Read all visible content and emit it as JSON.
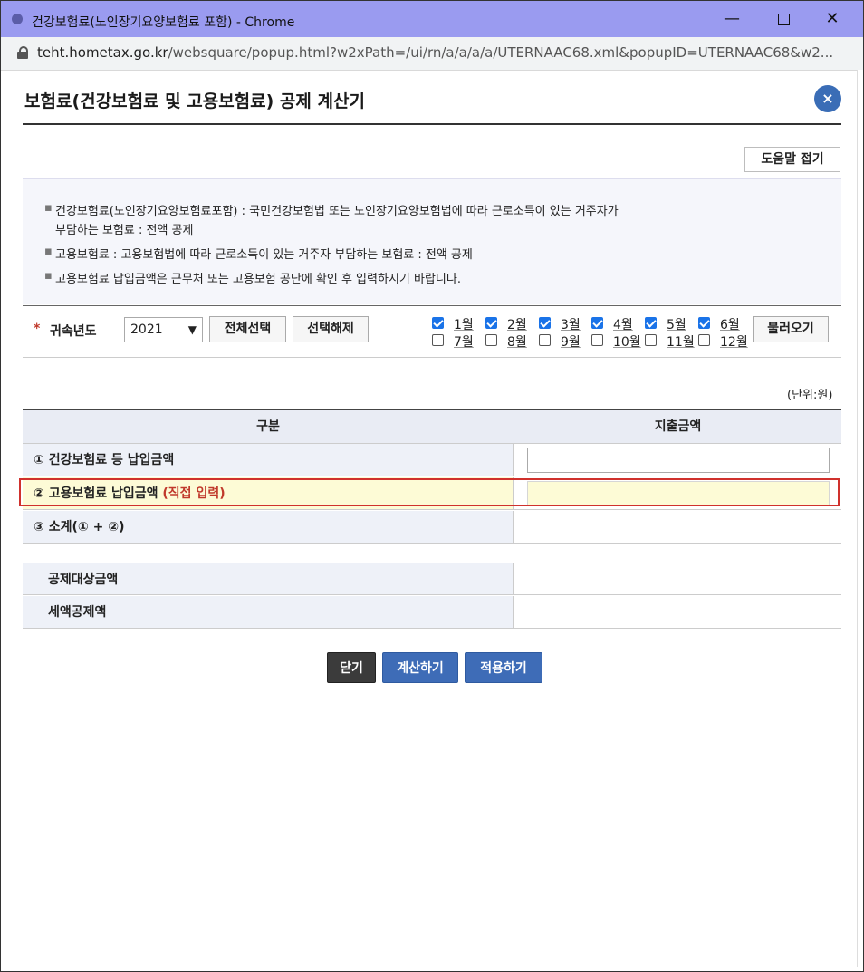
{
  "window": {
    "title": "건강보험료(노인장기요양보험료 포함) - Chrome",
    "url_domain": "teht.hometax.go.kr",
    "url_path": "/websquare/popup.html?w2xPath=/ui/rn/a/a/a/a/UTERNAAC68.xml&popupID=UTERNAAC68&w2..."
  },
  "dialog": {
    "title": "보험료(건강보험료 및 고용보험료) 공제 계산기",
    "close_glyph": "×"
  },
  "help": {
    "toggle_label": "도움말 접기",
    "lines": [
      "건강보험료(노인장기요양보험료포함) : 국민건강보험법 또는 노인장기요양보험법에 따라 근로소득이 있는 거주자가",
      "부담하는 보험료 : 전액 공제",
      "고용보험료 : 고용보험법에 따라 근로소득이 있는 거주자 부담하는 보험료 : 전액 공제",
      "고용보험료 납입금액은 근무처 또는 고용보험 공단에 확인 후 입력하시기 바랍니다."
    ]
  },
  "controls": {
    "required_mark": "*",
    "year_label": "귀속년도",
    "year_value": "2021",
    "select_all_label": "전체선택",
    "clear_selection_label": "선택해제",
    "load_label": "불러오기",
    "months": [
      {
        "label": "1월",
        "checked": true
      },
      {
        "label": "2월",
        "checked": true
      },
      {
        "label": "3월",
        "checked": true
      },
      {
        "label": "4월",
        "checked": true
      },
      {
        "label": "5월",
        "checked": true
      },
      {
        "label": "6월",
        "checked": true
      },
      {
        "label": "7월",
        "checked": false
      },
      {
        "label": "8월",
        "checked": false
      },
      {
        "label": "9월",
        "checked": false
      },
      {
        "label": "10월",
        "checked": false
      },
      {
        "label": "11월",
        "checked": false
      },
      {
        "label": "12월",
        "checked": false
      }
    ]
  },
  "table": {
    "unit": "(단위:원)",
    "header_category": "구분",
    "header_amount": "지출금액",
    "row1_label": "① 건강보험료 등 납입금액",
    "row2_label": "② 고용보험료 납입금액",
    "row2_note": "(직접 입력)",
    "row3_label": "③ 소계(① + ②)",
    "deduction_target_label": "공제대상금액",
    "tax_credit_label": "세액공제액"
  },
  "buttons": {
    "close": "닫기",
    "calculate": "계산하기",
    "apply": "적용하기"
  },
  "colors": {
    "title_bar": "#9a9bf0",
    "primary_button": "#3e6cb7",
    "highlight_border": "#d0312d",
    "input_highlight": "#fdfbd6"
  }
}
